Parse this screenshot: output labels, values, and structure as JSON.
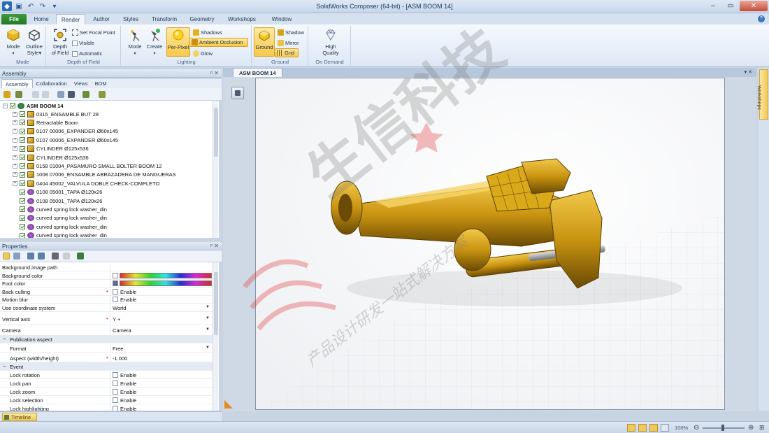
{
  "app": {
    "title": "SolidWorks Composer (64-bit) - [ASM BOOM 14]"
  },
  "menu_tabs": [
    "File",
    "Home",
    "Render",
    "Author",
    "Styles",
    "Transform",
    "Geometry",
    "Workshops",
    "Window"
  ],
  "ribbon": {
    "mode_group": {
      "label": "Mode",
      "mode": "Mode",
      "outline_style": [
        "Outline",
        "Style"
      ]
    },
    "dof_group": {
      "label": "Depth of Field",
      "depth": [
        "Depth",
        "of Field"
      ],
      "set_focal_point": "Set Focal Point",
      "visible": "Visible",
      "automatic": "Automatic"
    },
    "lighting_group": {
      "label": "Lighting",
      "mode": "Mode",
      "create": "Create",
      "per_pixel": "Per-Pixel",
      "shadows": "Shadows",
      "ambient_occlusion": "Ambient Occlusion",
      "glow": "Glow"
    },
    "ground_group": {
      "label": "Ground",
      "ground": "Ground",
      "shadow": "Shadow",
      "mirror": "Mirror",
      "grid": "Grid"
    },
    "ondemand_group": {
      "label": "On Demand",
      "high_quality": [
        "High",
        "Quality"
      ]
    }
  },
  "assembly_panel": {
    "title": "Assembly",
    "tabs": [
      "Assembly",
      "Collaboration",
      "Views",
      "BOM"
    ],
    "root": "ASM BOOM 14",
    "items": [
      {
        "label": "0315_ENSAMBLE BUT 28",
        "kind": "asm"
      },
      {
        "label": "Retractable Boom",
        "kind": "asm"
      },
      {
        "label": "0107 00006_EXPANDER Ø60x145",
        "kind": "asm"
      },
      {
        "label": "0107 00006_EXPANDER Ø60x145",
        "kind": "asm"
      },
      {
        "label": "CYLINDER Ø125x536",
        "kind": "asm"
      },
      {
        "label": "CYLINDER Ø125x536",
        "kind": "asm"
      },
      {
        "label": "0158 01004_PASAMURO SMALL BOLTER BOOM 12",
        "kind": "asm"
      },
      {
        "label": "1008 07006_ENSAMBLE ABRAZADERA DE MANGUERAS",
        "kind": "asm"
      },
      {
        "label": "0404 45002_VALVULA DOBLE CHECK-COMPLETO",
        "kind": "asm"
      },
      {
        "label": "0108 05001_TAPA Ø120x26",
        "kind": "part"
      },
      {
        "label": "0108 05001_TAPA Ø120x26",
        "kind": "part"
      },
      {
        "label": "curved spring lock washer_din",
        "kind": "part"
      },
      {
        "label": "curved spring lock washer_din",
        "kind": "part"
      },
      {
        "label": "curved spring lock washer_din",
        "kind": "part"
      },
      {
        "label": "curved spring lock washer_din",
        "kind": "part"
      },
      {
        "label": "curved spring lock washer_din",
        "kind": "part"
      }
    ]
  },
  "properties_panel": {
    "title": "Properties",
    "rows": [
      {
        "key": "Background image path",
        "value": "",
        "type": "text"
      },
      {
        "key": "Background color",
        "value": "",
        "type": "color"
      },
      {
        "key": "Foot color",
        "value": "",
        "type": "color"
      },
      {
        "key": "Back culling",
        "value": "Enable",
        "type": "check",
        "modified": true
      },
      {
        "key": "Motion blur",
        "value": "Enable",
        "type": "check"
      },
      {
        "key": "Use coordinate system",
        "value": "World",
        "type": "dropdown"
      },
      {
        "key": "Vertical axis",
        "value": "Y +",
        "type": "dropdown",
        "modified": true
      },
      {
        "key": "Camera",
        "value": "Camera",
        "type": "dropdown"
      },
      {
        "key": "Publication aspect",
        "value": "",
        "type": "category"
      },
      {
        "key": "Format",
        "value": "Free",
        "type": "dropdown",
        "indent": true
      },
      {
        "key": "Aspect (width/height)",
        "value": "-1.000",
        "type": "text",
        "indent": true,
        "modified": true
      },
      {
        "key": "Event",
        "value": "",
        "type": "category"
      },
      {
        "key": "Lock rotation",
        "value": "Enable",
        "type": "check",
        "indent": true
      },
      {
        "key": "Lock pan",
        "value": "Enable",
        "type": "check",
        "indent": true
      },
      {
        "key": "Lock zoom",
        "value": "Enable",
        "type": "check",
        "indent": true
      },
      {
        "key": "Lock selection",
        "value": "Enable",
        "type": "check",
        "indent": true
      },
      {
        "key": "Lock highlighting",
        "value": "Enable",
        "type": "check",
        "indent": true
      }
    ]
  },
  "timeline_tab": "Timeline",
  "viewport": {
    "tab": "ASM BOOM 14"
  },
  "workshops_dock": "Workshops",
  "status": {
    "zoom": "100%"
  },
  "watermark": {
    "big": "生信科技",
    "small": "产品设计研发一站式解决方案"
  },
  "colors": {
    "model_yellow": "#d8a410",
    "accent_active": "#f8c94a",
    "file_tab": "#2a8a2f"
  }
}
